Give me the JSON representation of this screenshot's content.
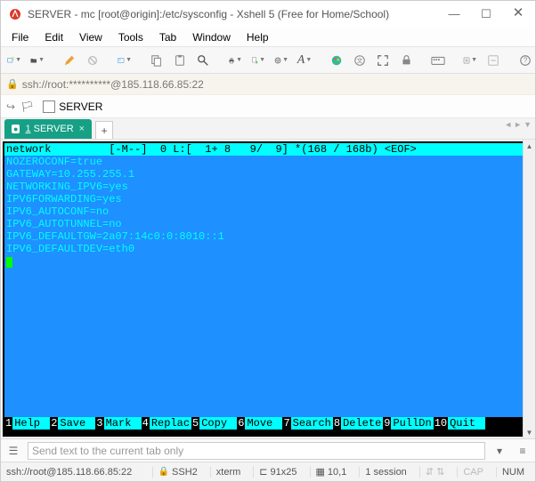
{
  "title": "SERVER - mc [root@origin]:/etc/sysconfig - Xshell 5 (Free for Home/School)",
  "menu": [
    "File",
    "Edit",
    "View",
    "Tools",
    "Tab",
    "Window",
    "Help"
  ],
  "address": "ssh://root:**********@185.118.66.85:22",
  "bookmark": {
    "name": "SERVER"
  },
  "session_tab": {
    "number": "1",
    "label": "SERVER"
  },
  "terminal": {
    "status": "network         [-M--]  0 L:[  1+ 8   9/  9] *(168 / 168b) <EOF>",
    "lines": [
      "NOZEROCONF=true",
      "GATEWAY=10.255.255.1",
      "NETWORKING_IPV6=yes",
      "IPV6FORWARDING=yes",
      "IPV6_AUTOCONF=no",
      "IPV6_AUTOTUNNEL=no",
      "IPV6_DEFAULTGW=2a07:14c0:0:8010::1",
      "IPV6_DEFAULTDEV=eth0"
    ],
    "fkeys": [
      {
        "n": "1",
        "l": "Help  "
      },
      {
        "n": "2",
        "l": "Save  "
      },
      {
        "n": "3",
        "l": "Mark  "
      },
      {
        "n": "4",
        "l": "Replac"
      },
      {
        "n": "5",
        "l": "Copy  "
      },
      {
        "n": "6",
        "l": "Move  "
      },
      {
        "n": "7",
        "l": "Search"
      },
      {
        "n": "8",
        "l": "Delete"
      },
      {
        "n": "9",
        "l": "PullDn"
      },
      {
        "n": "10",
        "l": "Quit "
      }
    ]
  },
  "input_placeholder": "Send text to the current tab only",
  "status": {
    "conn": "ssh://root@185.118.66.85:22",
    "proto": "SSH2",
    "term": "xterm",
    "size": "91x25",
    "pos": "10,1",
    "sessions": "1 session",
    "cap": "CAP",
    "num": "NUM"
  }
}
